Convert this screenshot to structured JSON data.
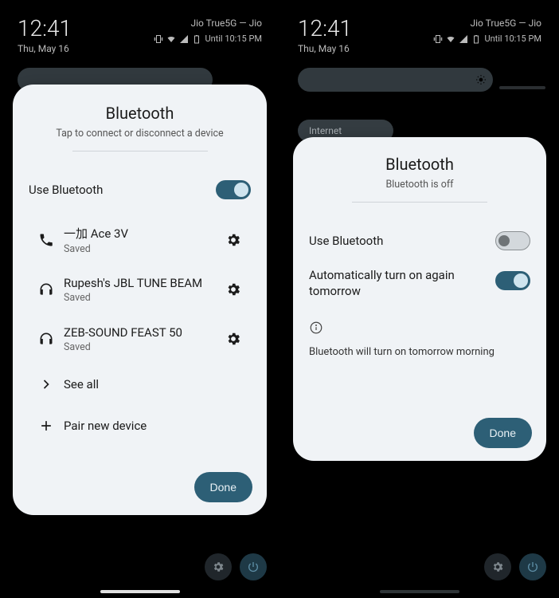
{
  "statusbar": {
    "time": "12:41",
    "date": "Thu, May 16",
    "carrier": "Jio True5G — Jio",
    "alarm": "Until 10:15 PM"
  },
  "left": {
    "title": "Bluetooth",
    "subtitle": "Tap to connect or disconnect a device",
    "use_bt_label": "Use Bluetooth",
    "devices": [
      {
        "name": "一加 Ace 3V",
        "sub": "Saved",
        "icon": "phone"
      },
      {
        "name": "Rupesh's JBL TUNE BEAM",
        "sub": "Saved",
        "icon": "headphones"
      },
      {
        "name": "ZEB-SOUND FEAST 50",
        "sub": "Saved",
        "icon": "headphones"
      }
    ],
    "see_all": "See all",
    "pair_new": "Pair new device",
    "done": "Done"
  },
  "right": {
    "pill2_label": "Internet",
    "title": "Bluetooth",
    "subtitle": "Bluetooth is off",
    "use_bt_label": "Use Bluetooth",
    "auto_label": "Automatically turn on again tomorrow",
    "info_text": "Bluetooth will turn on tomorrow morning",
    "done": "Done"
  }
}
